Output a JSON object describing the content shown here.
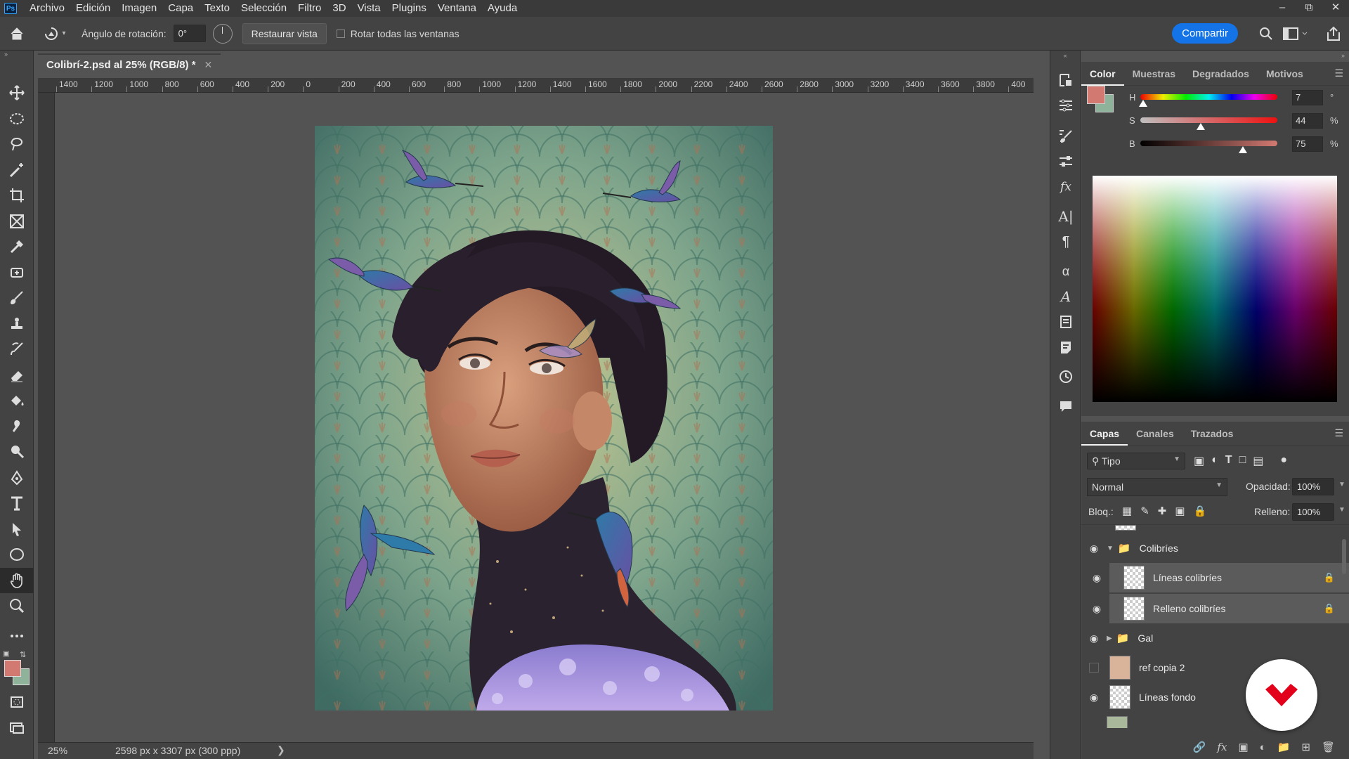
{
  "app": {
    "logo": "Ps"
  },
  "menu": [
    "Archivo",
    "Edición",
    "Imagen",
    "Capa",
    "Texto",
    "Selección",
    "Filtro",
    "3D",
    "Vista",
    "Plugins",
    "Ventana",
    "Ayuda"
  ],
  "options": {
    "rotation_label": "Ángulo de rotación:",
    "rotation_value": "0°",
    "reset_view": "Restaurar vista",
    "rotate_all": "Rotar todas las ventanas",
    "share": "Compartir"
  },
  "document": {
    "tab_title": "Colibrí-2.psd al 25% (RGB/8) *",
    "ruler_labels": [
      "1400",
      "1200",
      "1000",
      "800",
      "600",
      "400",
      "200",
      "0",
      "200",
      "400",
      "600",
      "800",
      "1000",
      "1200",
      "1400",
      "1600",
      "1800",
      "2000",
      "2200",
      "2400",
      "2600",
      "2800",
      "3000",
      "3200",
      "3400",
      "3600",
      "3800",
      "400"
    ],
    "zoom": "25%",
    "dimensions": "2598 px x 3307 px (300 ppp)"
  },
  "color_panel": {
    "tabs": [
      "Color",
      "Muestras",
      "Degradados",
      "Motivos"
    ],
    "foreground": "#d27a72",
    "background": "#8fb29a",
    "h": {
      "label": "H",
      "value": "7",
      "unit": "°"
    },
    "s": {
      "label": "S",
      "value": "44",
      "unit": "%"
    },
    "b": {
      "label": "B",
      "value": "75",
      "unit": "%"
    }
  },
  "layers_panel": {
    "tabs": [
      "Capas",
      "Canales",
      "Trazados"
    ],
    "filter": "Tipo",
    "blend_mode": "Normal",
    "opacity_label": "Opacidad:",
    "opacity_value": "100%",
    "lock_label": "Bloq.:",
    "fill_label": "Relleno:",
    "fill_value": "100%",
    "layers": [
      {
        "name": "Colibríes",
        "kind": "group",
        "visible": true
      },
      {
        "name": "Líneas colibríes",
        "kind": "layer",
        "visible": true,
        "locked": true
      },
      {
        "name": "Relleno colibríes",
        "kind": "layer",
        "visible": true,
        "locked": true
      },
      {
        "name": "Gal",
        "kind": "group",
        "visible": true
      },
      {
        "name": "ref copia 2",
        "kind": "layer",
        "visible": false
      },
      {
        "name": "Líneas fondo",
        "kind": "layer",
        "visible": true
      }
    ]
  },
  "colors": {
    "accent": "#1473e6",
    "logo_red": "#e2001a"
  }
}
